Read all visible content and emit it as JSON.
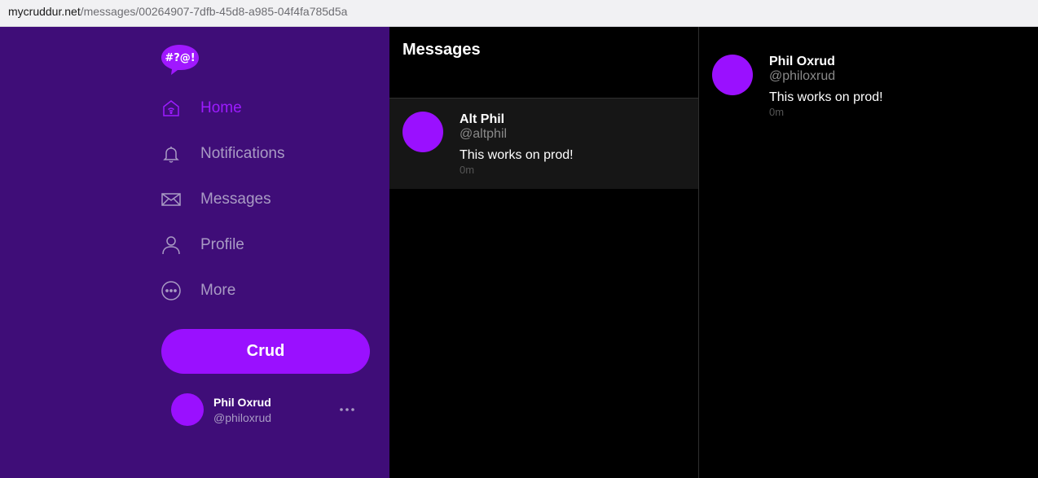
{
  "browser": {
    "url_domain": "mycruddur.net",
    "url_path": "/messages/00264907-7dfb-45d8-a985-04f4fa785d5a"
  },
  "logo": {
    "text": "#?@!",
    "icon": "speech-bubble-logo-icon"
  },
  "nav": {
    "items": [
      {
        "label": "Home",
        "icon": "home-icon",
        "active": true
      },
      {
        "label": "Notifications",
        "icon": "bell-icon",
        "active": false
      },
      {
        "label": "Messages",
        "icon": "envelope-icon",
        "active": false
      },
      {
        "label": "Profile",
        "icon": "person-icon",
        "active": false
      },
      {
        "label": "More",
        "icon": "more-circle-icon",
        "active": false
      }
    ]
  },
  "crud_button": {
    "label": "Crud"
  },
  "account": {
    "name": "Phil Oxrud",
    "handle": "@philoxrud"
  },
  "messages": {
    "title": "Messages",
    "conversations": [
      {
        "name": "Alt Phil",
        "handle": "@altphil",
        "message": "This works on prod!",
        "time": "0m"
      }
    ]
  },
  "thread": {
    "messages": [
      {
        "name": "Phil Oxrud",
        "handle": "@philoxrud",
        "message": "This works on prod!",
        "time": "0m"
      }
    ]
  },
  "colors": {
    "sidebar_bg": "#3f0d78",
    "accent": "#9a10ff",
    "nav_inactive": "#a99bc4"
  }
}
